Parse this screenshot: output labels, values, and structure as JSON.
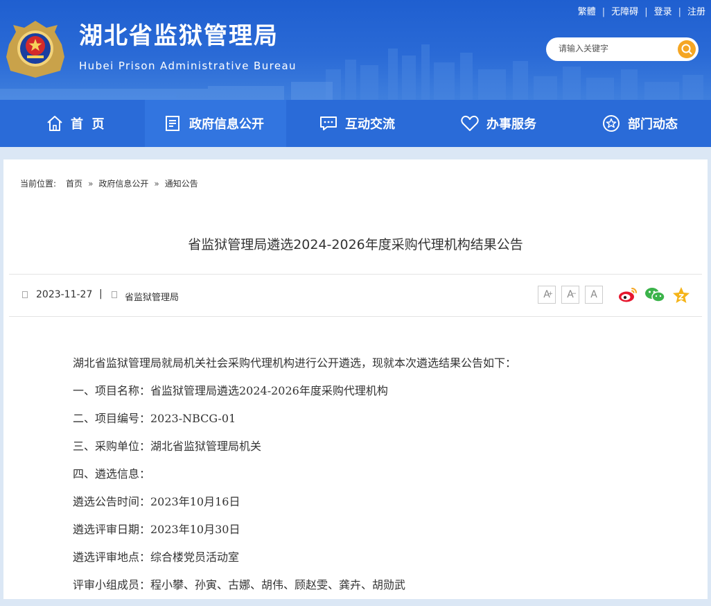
{
  "header": {
    "top_links": [
      "繁體",
      "无障碍",
      "登录",
      "注册"
    ],
    "title": "湖北省监狱管理局",
    "subtitle": "Hubei Prison Administrative Bureau",
    "search_placeholder": "请输入关键字",
    "emblem_icon": "police-emblem-icon"
  },
  "nav": {
    "items": [
      {
        "label": "首  页",
        "icon": "home-icon"
      },
      {
        "label": "政府信息公开",
        "icon": "document-icon"
      },
      {
        "label": "互动交流",
        "icon": "chat-icon"
      },
      {
        "label": "办事服务",
        "icon": "heart-icon"
      },
      {
        "label": "部门动态",
        "icon": "star-icon"
      }
    ],
    "active_index": 1
  },
  "breadcrumb": {
    "prefix": "当前位置:",
    "items": [
      "首页",
      "政府信息公开",
      "通知公告"
    ],
    "separator": "»"
  },
  "article": {
    "title": "省监狱管理局遴选2024-2026年度采购代理机构结果公告",
    "date": "2023-11-27",
    "meta_separator": "|",
    "source": "省监狱管理局",
    "font_size_buttons": [
      "A",
      "A",
      "A"
    ],
    "share_icons": [
      "weibo-icon",
      "wechat-icon",
      "favorite-icon"
    ],
    "paragraphs": [
      "湖北省监狱管理局就局机关社会采购代理机构进行公开遴选，现就本次遴选结果公告如下：",
      "一、项目名称：省监狱管理局遴选2024-2026年度采购代理机构",
      "二、项目编号：2023-NBCG-01",
      "三、采购单位：湖北省监狱管理局机关",
      "四、遴选信息：",
      "遴选公告时间：2023年10月16日",
      "遴选评审日期：2023年10月30日",
      "遴选评审地点：综合楼党员活动室",
      "评审小组成员：程小攀、孙寅、古娜、胡伟、顾赵雯、龚卉、胡勋武"
    ]
  },
  "colors": {
    "header_blue": "#1f5fd0",
    "nav_blue": "#2a6bd8",
    "search_button": "#f5a623",
    "page_background": "#dbe7f5"
  }
}
